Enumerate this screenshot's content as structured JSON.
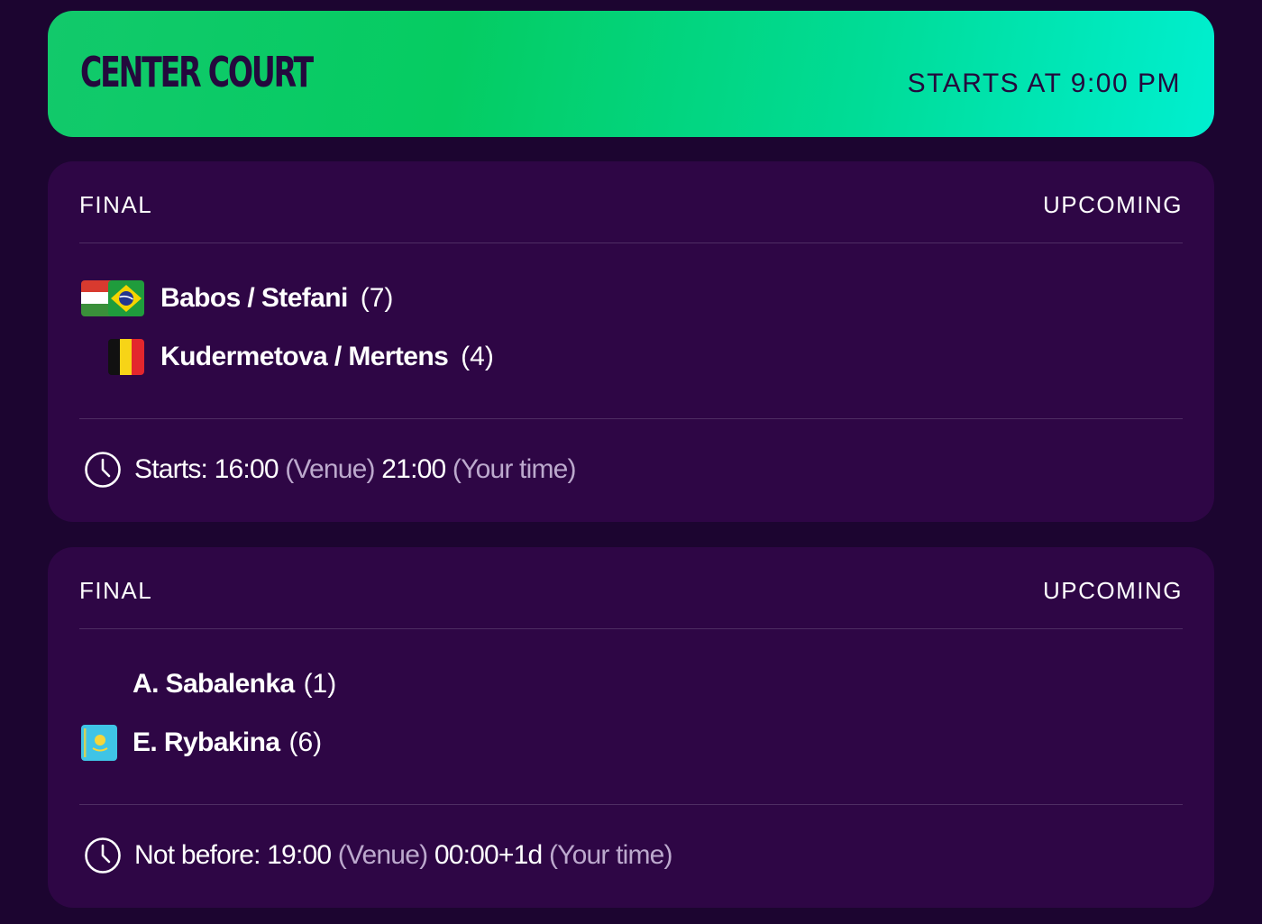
{
  "court": {
    "title": "CENTER COURT",
    "starts": "STARTS AT 9:00 PM"
  },
  "matches": [
    {
      "round": "FINAL",
      "status": "UPCOMING",
      "players": [
        {
          "name": "Babos / Stefani",
          "seed": "(7)",
          "flags": [
            "hungary-flag",
            "brazil-flag"
          ]
        },
        {
          "name": "Kudermetova / Mertens",
          "seed": "(4)",
          "flags": [
            "belgium-flag"
          ]
        }
      ],
      "time": {
        "prefix": "Starts:",
        "venue_time": "16:00",
        "venue_label": "(Venue)",
        "local_time": "21:00",
        "local_label": "(Your time)"
      }
    },
    {
      "round": "FINAL",
      "status": "UPCOMING",
      "players": [
        {
          "name": "A. Sabalenka",
          "seed": "(1)",
          "flags": []
        },
        {
          "name": "E. Rybakina",
          "seed": "(6)",
          "flags": [
            "kazakhstan-flag"
          ]
        }
      ],
      "time": {
        "prefix": "Not before:",
        "venue_time": "19:00",
        "venue_label": "(Venue)",
        "local_time": "00:00+1d",
        "local_label": "(Your time)"
      }
    }
  ],
  "colors": {
    "background": "#1c0530",
    "card": "#2e0645",
    "header_gradient_start": "#12c96b",
    "header_gradient_end": "#00efd0",
    "header_text": "#24093d",
    "muted_text": "#bca9cd"
  }
}
